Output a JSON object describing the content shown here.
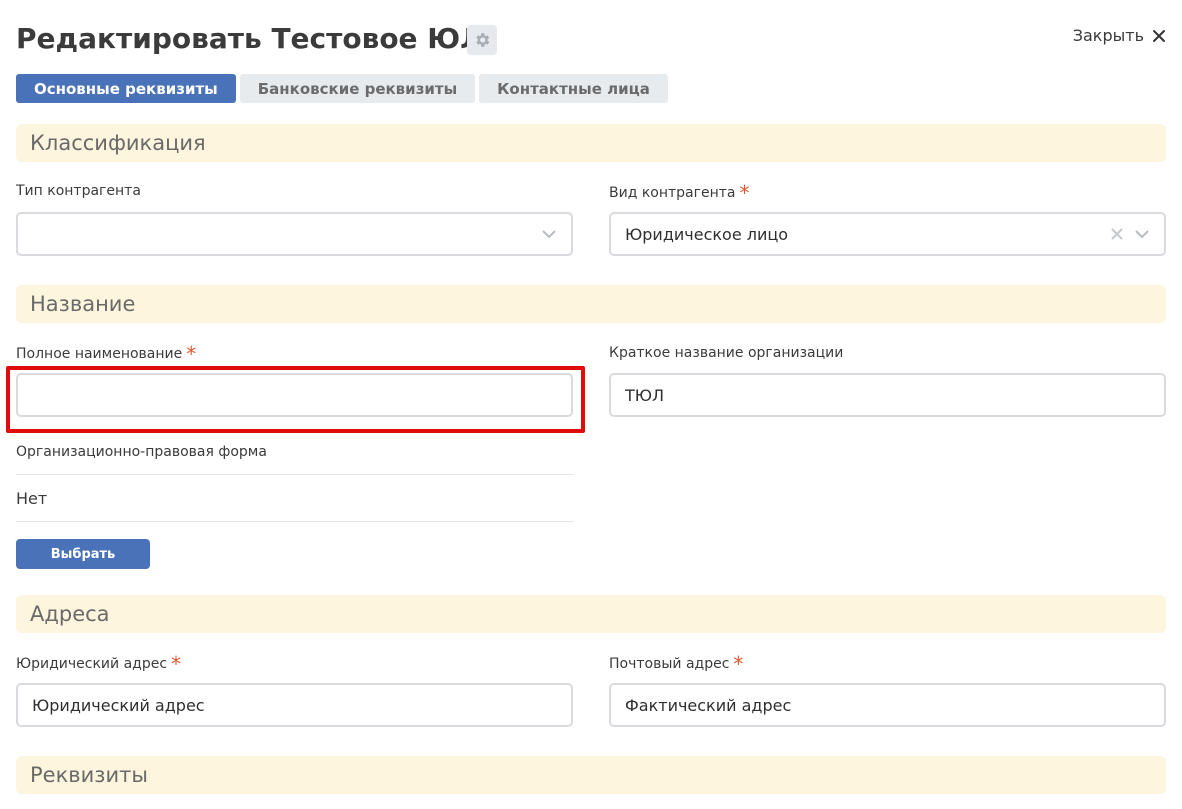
{
  "header": {
    "title": "Редактировать Тестовое ЮЛ",
    "close_label": "Закрыть"
  },
  "tabs": [
    {
      "label": "Основные реквизиты",
      "active": true
    },
    {
      "label": "Банковские реквизиты",
      "active": false
    },
    {
      "label": "Контактные лица",
      "active": false
    }
  ],
  "sections": {
    "classification": "Классификация",
    "name": "Название",
    "addresses": "Адреса",
    "requisites": "Реквизиты"
  },
  "classification": {
    "type_label": "Тип контрагента",
    "type_value": "",
    "kind_label": "Вид контрагента",
    "kind_value": "Юридическое лицо"
  },
  "name": {
    "full_label": "Полное наименование",
    "full_value": "",
    "short_label": "Краткое название организации",
    "short_value": "ТЮЛ",
    "legal_form_label": "Организационно-правовая форма",
    "legal_form_value": "Нет",
    "select_button": "Выбрать"
  },
  "addresses": {
    "legal_label": "Юридический адрес",
    "legal_value": "Юридический адрес",
    "postal_label": "Почтовый адрес",
    "postal_value": "Фактический адрес"
  },
  "required_mark": "*",
  "colors": {
    "accent": "#4a72b8",
    "section_bg": "#fdf5dd",
    "required": "#e4572e",
    "highlight": "#e10b0b"
  }
}
